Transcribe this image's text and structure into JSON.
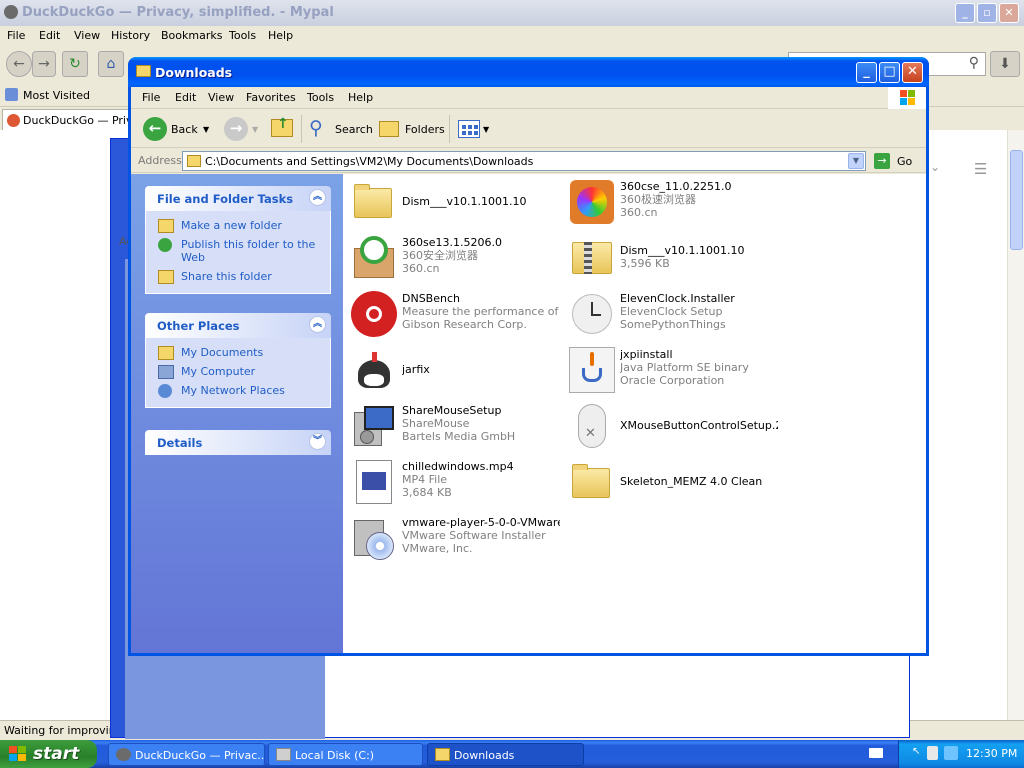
{
  "browser": {
    "title": "DuckDuckGo — Privacy, simplified. - Mypal",
    "menu": [
      "File",
      "Edit",
      "View",
      "History",
      "Bookmarks",
      "Tools",
      "Help"
    ],
    "bookmark": "Most Visited",
    "tab_title": "DuckDuckGo — Privacy, simplified.",
    "status": "Waiting for improving.duckduckgo.com...",
    "partial_text": "Ad"
  },
  "explorer": {
    "title": "Downloads",
    "menu": [
      "File",
      "Edit",
      "View",
      "Favorites",
      "Tools",
      "Help"
    ],
    "toolbar": {
      "back": "Back",
      "search": "Search",
      "folders": "Folders"
    },
    "address": {
      "label": "Address",
      "path": "C:\\Documents and Settings\\VM2\\My Documents\\Downloads",
      "go": "Go"
    },
    "tasks": {
      "title": "File and Folder Tasks",
      "items": [
        "Make a new folder",
        "Publish this folder to the Web",
        "Share this folder"
      ]
    },
    "places": {
      "title": "Other Places",
      "items": [
        "My Documents",
        "My Computer",
        "My Network Places"
      ]
    },
    "details": {
      "title": "Details"
    },
    "files": [
      {
        "name": "Dism___v10.1.1001.10",
        "sub1": "",
        "sub2": "",
        "icon": "folder-icon"
      },
      {
        "name": "360cse_11.0.2251.0",
        "sub1": "360极速浏览器",
        "sub2": "360.cn",
        "icon": "360cse-icon"
      },
      {
        "name": "360se13.1.5206.0",
        "sub1": "360安全浏览器",
        "sub2": "360.cn",
        "icon": "360se-icon"
      },
      {
        "name": "Dism___v10.1.1001.10",
        "sub1": "3,596 KB",
        "sub2": "",
        "icon": "zip-folder-icon"
      },
      {
        "name": "DNSBench",
        "sub1": "Measure the performance of ...",
        "sub2": "Gibson Research Corp.",
        "icon": "dnsbench-icon"
      },
      {
        "name": "ElevenClock.Installer",
        "sub1": "ElevenClock Setup",
        "sub2": "SomePythonThings",
        "icon": "clock-icon"
      },
      {
        "name": "jarfix",
        "sub1": "",
        "sub2": "",
        "icon": "jarfix-icon"
      },
      {
        "name": "jxpiinstall",
        "sub1": "Java Platform SE binary",
        "sub2": "Oracle Corporation",
        "icon": "java-icon"
      },
      {
        "name": "ShareMouseSetup",
        "sub1": "ShareMouse",
        "sub2": "Bartels Media GmbH",
        "icon": "installer-icon"
      },
      {
        "name": "XMouseButtonControlSetup.2....",
        "sub1": "",
        "sub2": "",
        "icon": "mouse-icon"
      },
      {
        "name": "chilledwindows.mp4",
        "sub1": "MP4 File",
        "sub2": "3,684 KB",
        "icon": "video-file-icon"
      },
      {
        "name": "Skeleton_MEMZ 4.0 Clean",
        "sub1": "",
        "sub2": "",
        "icon": "folder-icon"
      },
      {
        "name": "vmware-player-5-0-0-VMware...",
        "sub1": "VMware Software Installer",
        "sub2": "VMware, Inc.",
        "icon": "vmware-installer-icon"
      }
    ]
  },
  "taskbar": {
    "start": "start",
    "tasks": [
      "DuckDuckGo — Privac...",
      "Local Disk (C:)",
      "Downloads"
    ],
    "clock": "12:30 PM"
  }
}
